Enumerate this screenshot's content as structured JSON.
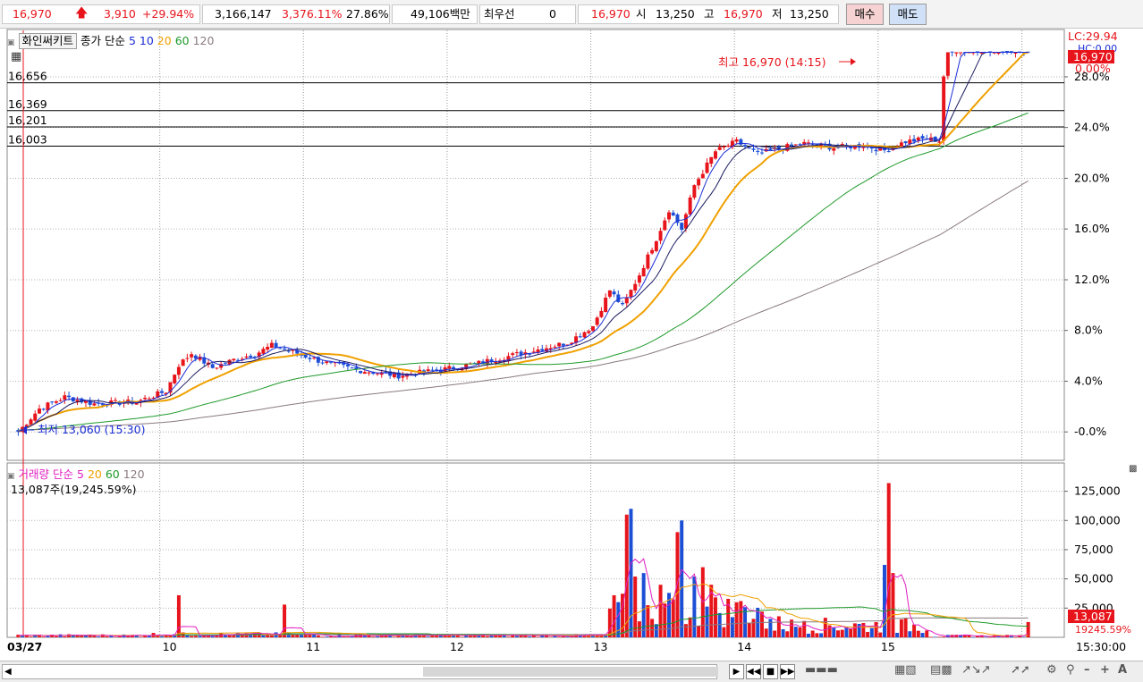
{
  "quote": {
    "price": "16,970",
    "change": "3,910",
    "change_pct": "+29.94%",
    "volume": "3,166,147",
    "volume_pct": "3,376.11%",
    "turnover_pct": "27.86%",
    "amount": "49,106백만",
    "priority_label": "최우선",
    "priority_value": "0",
    "price2": "16,970",
    "open_label": "시",
    "open": "13,250",
    "high_label": "고",
    "high": "16,970",
    "low_label": "저",
    "low": "13,250",
    "buy": "매수",
    "sell": "매도"
  },
  "price_legend": {
    "name": "화인써키트",
    "type": "종가 단순",
    "ma": [
      "5",
      "10",
      "20",
      "60",
      "120"
    ]
  },
  "volume_legend": {
    "name": "거래량",
    "type": "단순",
    "ma": [
      "5",
      "20",
      "60",
      "120"
    ],
    "current": "13,087주(19,245.59%)"
  },
  "colors": {
    "up": "#e8141b",
    "down": "#1c4fd6",
    "ma5": "#1c2fd6",
    "ma10": "#1a1a60",
    "ma20": "#f0a000",
    "ma60": "#1e9a2a",
    "ma120": "#8a7a80",
    "vma5": "#e020c0",
    "vma20": "#f0a000",
    "vma60": "#1e9a2a",
    "vma120": "#8a7a80"
  },
  "chart_data": [
    {
      "type": "candlestick",
      "title": "화인써키트",
      "x": [
        "03/27",
        "10",
        "11",
        "12",
        "13",
        "14",
        "15"
      ],
      "ylim": [
        12970,
        17140
      ],
      "y_ticks": [
        "-0.0%",
        "4.0%",
        "8.0%",
        "12.0%",
        "16.0%",
        "20.0%",
        "24.0%",
        "28.0%"
      ],
      "y_tick_prices": [
        13060,
        13582,
        14105,
        14627,
        15150,
        15672,
        16195,
        16717
      ],
      "horizontal_lines": [
        "16,656",
        "16,369",
        "16,201",
        "16,003"
      ],
      "horizontal_line_prices": [
        16656,
        16369,
        16201,
        16003
      ],
      "annotations": {
        "high": "최고 16,970 (14:15)",
        "low": "최저 13,060 (15:30)",
        "lc": "LC:29.94",
        "hc": "HC:0.00",
        "last": "16,970",
        "last_pct": "0.00%"
      },
      "close_anchors": [
        [
          0,
          13060
        ],
        [
          5,
          13300
        ],
        [
          11,
          13420
        ],
        [
          18,
          13350
        ],
        [
          28,
          13370
        ],
        [
          35,
          13480
        ],
        [
          38,
          13750
        ],
        [
          41,
          13870
        ],
        [
          46,
          13720
        ],
        [
          52,
          13820
        ],
        [
          56,
          13860
        ],
        [
          60,
          13950
        ],
        [
          66,
          13870
        ],
        [
          72,
          13780
        ],
        [
          80,
          13700
        ],
        [
          90,
          13640
        ],
        [
          100,
          13700
        ],
        [
          108,
          13760
        ],
        [
          116,
          13840
        ],
        [
          124,
          13920
        ],
        [
          130,
          13980
        ],
        [
          136,
          14150
        ],
        [
          140,
          14520
        ],
        [
          143,
          14350
        ],
        [
          147,
          14680
        ],
        [
          151,
          15050
        ],
        [
          154,
          15350
        ],
        [
          157,
          15150
        ],
        [
          160,
          15600
        ],
        [
          165,
          15950
        ],
        [
          170,
          16050
        ],
        [
          175,
          15920
        ],
        [
          180,
          15980
        ],
        [
          186,
          16030
        ],
        [
          193,
          15990
        ],
        [
          200,
          16010
        ],
        [
          205,
          15960
        ],
        [
          210,
          16050
        ],
        [
          215,
          16080
        ],
        [
          218,
          16060
        ],
        [
          219,
          16720
        ],
        [
          220,
          16970
        ],
        [
          240,
          16970
        ]
      ],
      "moving_averages": [
        "5",
        "10",
        "20",
        "60",
        "120"
      ]
    },
    {
      "type": "bar",
      "title": "거래량",
      "ylim": [
        0,
        140000
      ],
      "y_ticks": [
        "25,000",
        "50,000",
        "75,000",
        "100,000",
        "125,000"
      ],
      "y_tick_values": [
        25000,
        50000,
        75000,
        100000,
        125000
      ],
      "last_value": "13,087",
      "last_ratio": "19245.59%",
      "peaks": [
        [
          38,
          36000
        ],
        [
          63,
          28000
        ],
        [
          144,
          105000
        ],
        [
          145,
          110000
        ],
        [
          146,
          52000
        ],
        [
          148,
          55000
        ],
        [
          152,
          45000
        ],
        [
          154,
          38000
        ],
        [
          156,
          90000
        ],
        [
          157,
          100000
        ],
        [
          160,
          52000
        ],
        [
          162,
          60000
        ],
        [
          164,
          45000
        ],
        [
          170,
          30000
        ],
        [
          176,
          22000
        ],
        [
          180,
          18000
        ],
        [
          186,
          14000
        ],
        [
          205,
          62000
        ],
        [
          206,
          132000
        ],
        [
          207,
          55000
        ],
        [
          239,
          13087
        ]
      ],
      "moving_averages": [
        "5",
        "20",
        "60",
        "120"
      ]
    }
  ]
}
